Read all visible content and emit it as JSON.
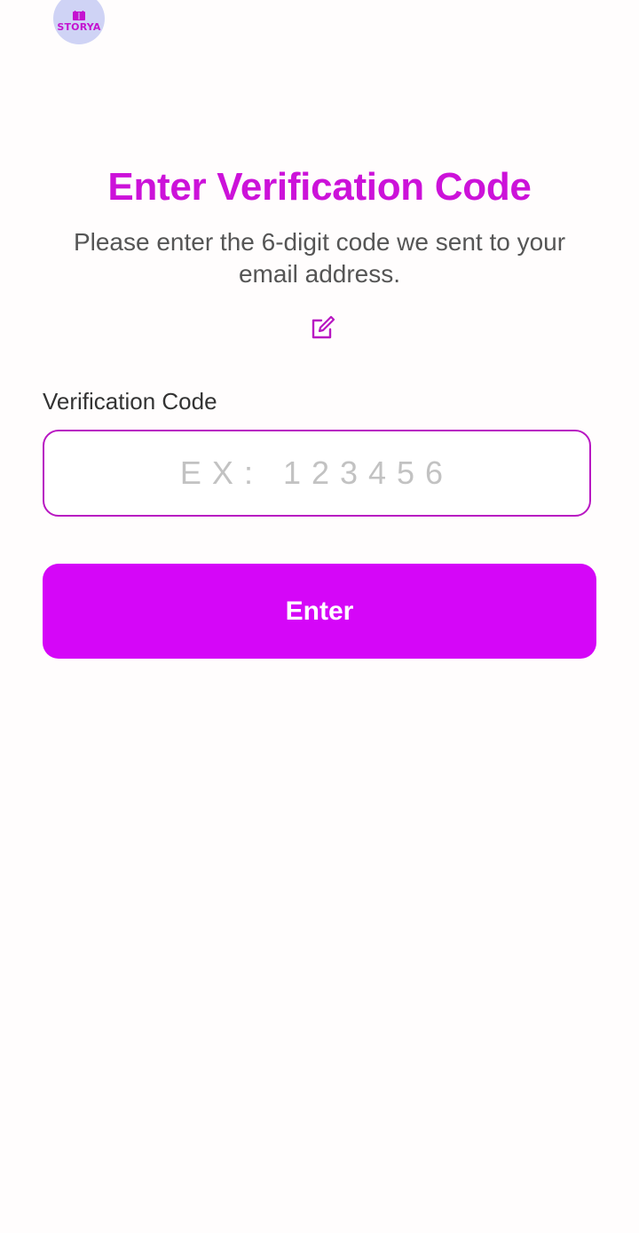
{
  "logo": {
    "text": "STORYA",
    "background": "#cfd3f5",
    "accent": "#c413cf"
  },
  "page": {
    "title": "Enter Verification Code",
    "subtitle": "Please enter the 6-digit code we sent to your email address.",
    "edit_icon": "edit-icon"
  },
  "form": {
    "label": "Verification Code",
    "code_value": "",
    "code_placeholder": "EX: 123456",
    "submit_label": "Enter"
  },
  "colors": {
    "accent": "#cc12d9",
    "button": "#d506f8",
    "input_border": "#b817c2",
    "background": "#fffdfd"
  }
}
